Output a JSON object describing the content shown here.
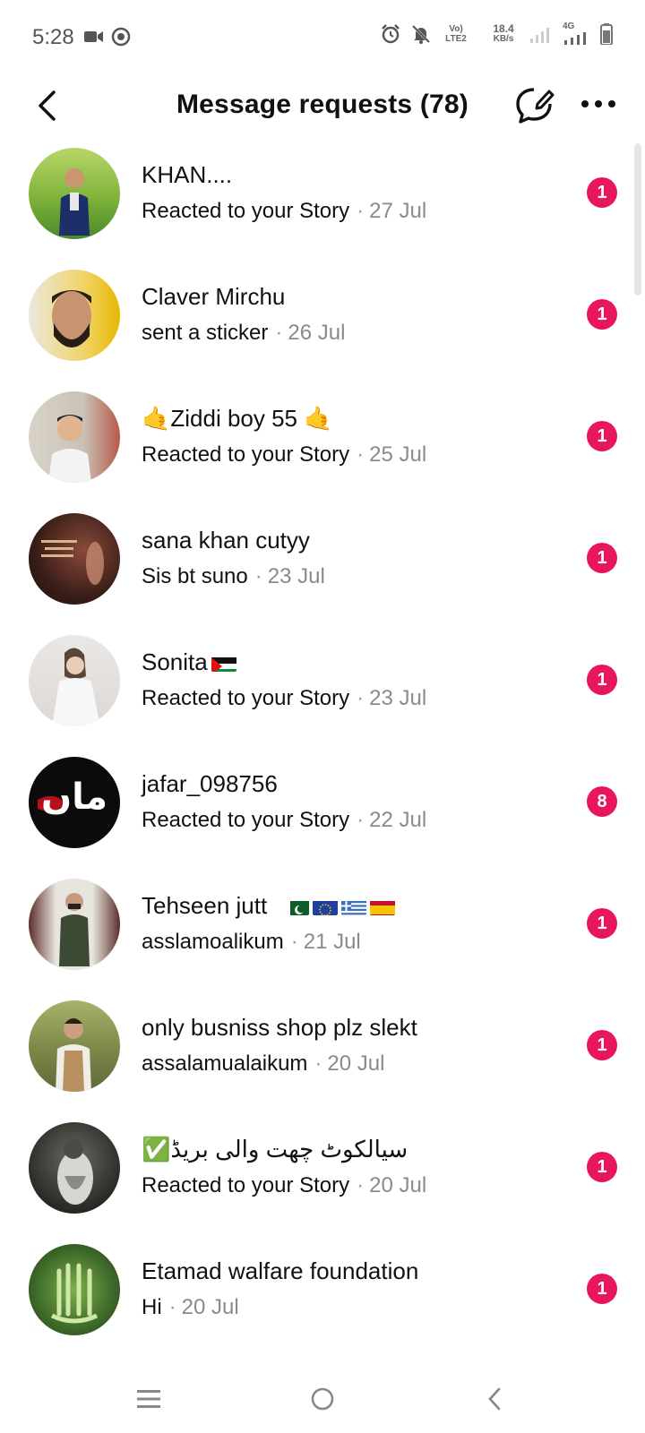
{
  "status_bar": {
    "time": "5:28",
    "lte_label": "LTE2",
    "speed_value": "18.4",
    "speed_unit": "KB/s",
    "network": "4G"
  },
  "header": {
    "title": "Message requests (78)"
  },
  "requests": [
    {
      "name": "KHAN....",
      "message": "Reacted to your Story",
      "date": "27 Jul",
      "badge": "1"
    },
    {
      "name": "Claver Mirchu",
      "message": "sent a sticker",
      "date": "26 Jul",
      "badge": "1"
    },
    {
      "name": "🤙Ziddi boy 55 🤙",
      "message": "Reacted to your Story",
      "date": "25 Jul",
      "badge": "1"
    },
    {
      "name": "sana khan cutyy",
      "message": "Sis bt suno",
      "date": "23 Jul",
      "badge": "1"
    },
    {
      "name": "Sonita",
      "message": "Reacted to your Story",
      "date": "23 Jul",
      "badge": "1"
    },
    {
      "name": "jafar_098756",
      "message": "Reacted to your Story",
      "date": "22 Jul",
      "badge": "8"
    },
    {
      "name": "Tehseen jutt",
      "message": "asslamoalikum",
      "date": "21 Jul",
      "badge": "1"
    },
    {
      "name": "only busniss shop plz slekt",
      "message": "assalamualaikum",
      "date": "20 Jul",
      "badge": "1"
    },
    {
      "name": "✅سیالکوٹ چھت والی بریڈ",
      "message": "Reacted to your Story",
      "date": "20 Jul",
      "badge": "1"
    },
    {
      "name": "Etamad walfare foundation",
      "message": "Hi",
      "date": "20 Jul",
      "badge": "1"
    }
  ],
  "colors": {
    "badge": "#e8175d",
    "text": "#111111",
    "muted": "#8a8a8a"
  },
  "avatar_text": {
    "jafar": "ماں"
  }
}
